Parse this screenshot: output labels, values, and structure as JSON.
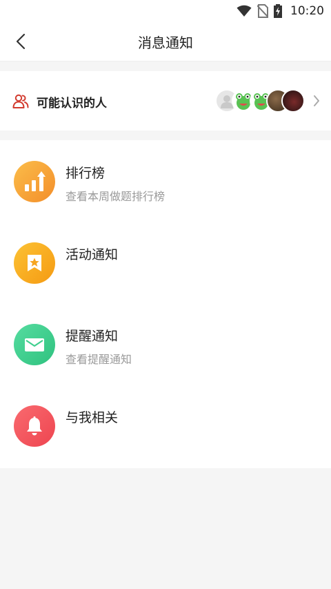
{
  "status_bar": {
    "time": "10:20",
    "icons": [
      "wifi-icon",
      "no-sim-icon",
      "battery-charging-icon"
    ]
  },
  "header": {
    "title": "消息通知",
    "back_icon": "chevron-left-icon"
  },
  "people": {
    "label": "可能认识的人",
    "icon": "people-icon",
    "accent": "#d23a2e",
    "avatars": [
      "default-avatar",
      "frog-avatar",
      "frog-avatar",
      "dark-avatar",
      "dark-avatar"
    ]
  },
  "items": [
    {
      "title": "排行榜",
      "subtitle": "查看本周做题排行榜",
      "icon": "chart-icon",
      "color": "#f5a33a"
    },
    {
      "title": "活动通知",
      "subtitle": "",
      "icon": "star-bookmark-icon",
      "color": "#f8b020"
    },
    {
      "title": "提醒通知",
      "subtitle": "查看提醒通知",
      "icon": "mail-icon",
      "color": "#3fcf8e"
    },
    {
      "title": "与我相关",
      "subtitle": "",
      "icon": "bell-icon",
      "color": "#f2545b"
    }
  ]
}
